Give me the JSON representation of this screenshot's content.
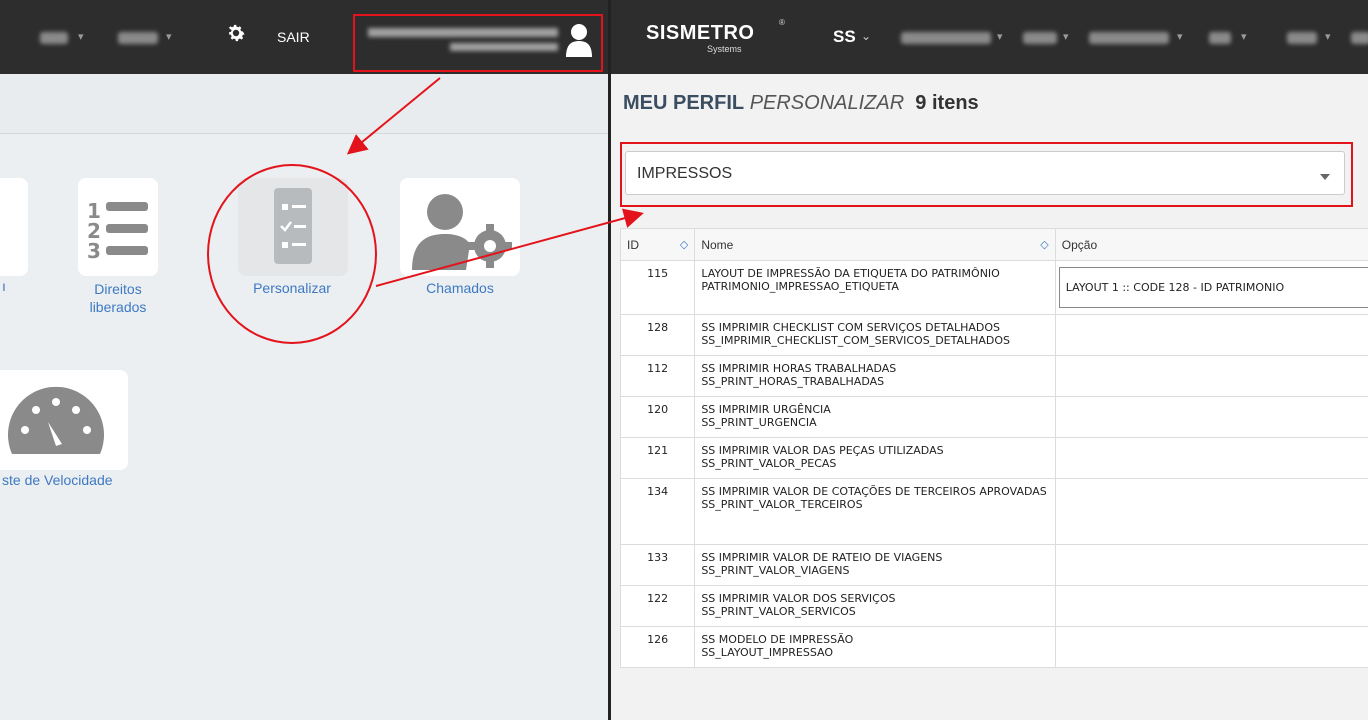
{
  "left": {
    "nav": {
      "logout_label": "SAIR"
    },
    "tiles": [
      {
        "label": "Direitos liberados"
      },
      {
        "label": "Personalizar"
      },
      {
        "label": "Chamados"
      },
      {
        "label": "ste de Velocidade"
      }
    ]
  },
  "right": {
    "brand": {
      "name": "SISMETRO",
      "sub": "Systems",
      "reg": "®"
    },
    "nav": {
      "ss_label": "SS"
    },
    "title": {
      "main": "MEU PERFIL",
      "sub": "PERSONALIZAR",
      "count": "9 itens"
    },
    "filter": {
      "selected": "IMPRESSOS"
    },
    "table": {
      "headers": {
        "id": "ID",
        "nome": "Nome",
        "opcao": "Opção"
      },
      "rows": [
        {
          "id": "115",
          "name": "LAYOUT DE IMPRESSÃO DA ETIQUETA DO PATRIMÔNIO",
          "code": "PATRIMONIO_IMPRESSAO_ETIQUETA",
          "option": "LAYOUT 1 :: CODE 128 - ID PATRIMONIO"
        },
        {
          "id": "128",
          "name": "SS IMPRIMIR CHECKLIST COM SERVIÇOS DETALHADOS",
          "code": "SS_IMPRIMIR_CHECKLIST_COM_SERVICOS_DETALHADOS",
          "option": ""
        },
        {
          "id": "112",
          "name": "SS IMPRIMIR HORAS TRABALHADAS",
          "code": "SS_PRINT_HORAS_TRABALHADAS",
          "option": ""
        },
        {
          "id": "120",
          "name": "SS IMPRIMIR URGÊNCIA",
          "code": "SS_PRINT_URGENCIA",
          "option": ""
        },
        {
          "id": "121",
          "name": "SS IMPRIMIR VALOR DAS PEÇAS UTILIZADAS",
          "code": "SS_PRINT_VALOR_PECAS",
          "option": ""
        },
        {
          "id": "134",
          "name": "SS IMPRIMIR VALOR DE COTAÇÕES DE TERCEIROS APROVADAS",
          "code": "SS_PRINT_VALOR_TERCEIROS",
          "option": ""
        },
        {
          "id": "133",
          "name": "SS IMPRIMIR VALOR DE RATEIO DE VIAGENS",
          "code": "SS_PRINT_VALOR_VIAGENS",
          "option": ""
        },
        {
          "id": "122",
          "name": "SS IMPRIMIR VALOR DOS SERVIÇOS",
          "code": "SS_PRINT_VALOR_SERVICOS",
          "option": ""
        },
        {
          "id": "126",
          "name": "SS MODELO DE IMPRESSÃO",
          "code": "SS_LAYOUT_IMPRESSAO",
          "option": ""
        }
      ]
    }
  },
  "colors": {
    "annotation_red": "#e3131b",
    "link_blue": "#3d79c3",
    "navbar": "#2d2d2d"
  }
}
